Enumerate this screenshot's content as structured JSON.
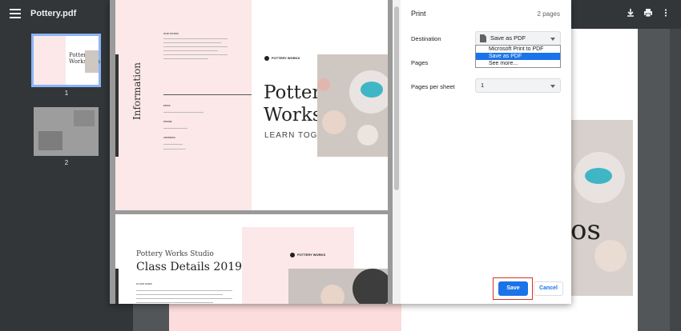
{
  "viewer": {
    "file_name": "Pottery.pdf",
    "thumbnails": [
      {
        "number": "1",
        "selected": true
      },
      {
        "number": "2",
        "selected": false
      }
    ],
    "toolbar_icons": [
      "download-icon",
      "print-icon",
      "more-vert-icon"
    ],
    "background_text": "os"
  },
  "print_dialog": {
    "title": "Print",
    "page_count": "2 pages",
    "destination": {
      "label": "Destination",
      "value": "Save as PDF",
      "options": [
        "Microsoft Print to PDF",
        "Save as PDF",
        "See more..."
      ],
      "selected_index": 1
    },
    "pages": {
      "label": "Pages"
    },
    "pages_per_sheet": {
      "label": "Pages per sheet",
      "value": "1"
    },
    "buttons": {
      "save": "Save",
      "cancel": "Cancel"
    },
    "colors": {
      "primary": "#1a73e8",
      "highlight_border": "#d93025"
    }
  },
  "preview": {
    "page1": {
      "vertical_title": "Information",
      "logo": "POTTERY WORKS",
      "title_line1": "Pottery",
      "title_line2": "Workshops",
      "subtitle": "LEARN TOGETHER",
      "section_our_studio": "OUR STUDIO",
      "section_email": "EMAIL",
      "section_phone": "PHONE",
      "section_address": "ADDRESS"
    },
    "page2": {
      "studio": "Pottery Works Studio",
      "title": "Class Details 2019",
      "logo": "POTTERY WORKS",
      "section": "CLASS GOES"
    }
  }
}
